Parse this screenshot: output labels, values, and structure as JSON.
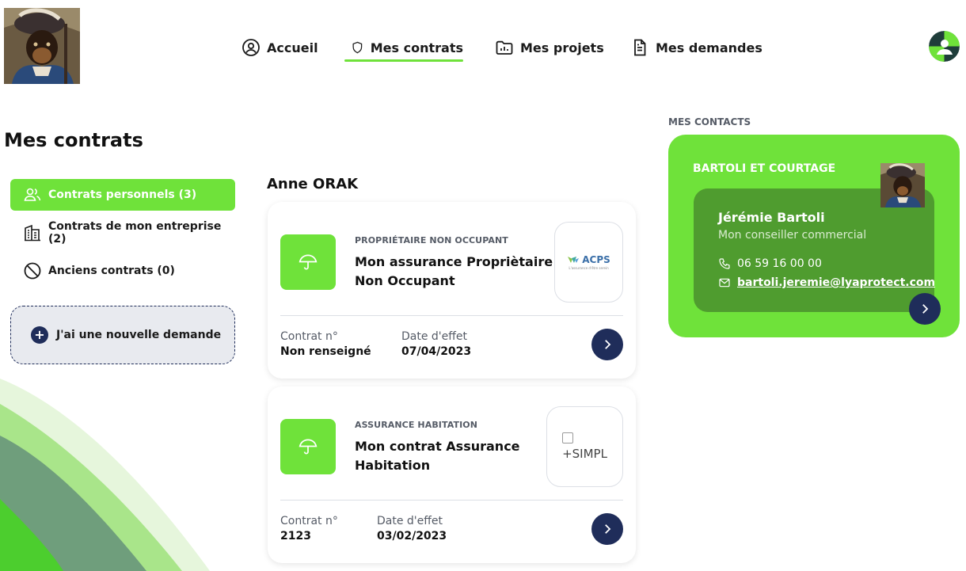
{
  "colors": {
    "accent": "#6fe23a",
    "dark_navy": "#1f2d5a",
    "advisor_box": "#4f9c2f"
  },
  "header": {
    "logo_icon": "dog-portrait-logo",
    "nav": [
      {
        "label": "Accueil",
        "icon": "user-circle-icon"
      },
      {
        "label": "Mes contrats",
        "icon": "shield-icon",
        "active": true
      },
      {
        "label": "Mes projets",
        "icon": "folder-chart-icon"
      },
      {
        "label": "Mes demandes",
        "icon": "document-icon"
      }
    ],
    "avatar_icon": "user-avatar-icon"
  },
  "page": {
    "title": "Mes contrats"
  },
  "sidebar": {
    "items": [
      {
        "label": "Contrats personnels (3)",
        "icon": "users-icon",
        "active": true
      },
      {
        "label": "Contrats de mon entreprise (2)",
        "icon": "building-icon"
      },
      {
        "label": "Anciens contrats (0)",
        "icon": "ban-icon"
      }
    ],
    "new_request_label": "J'ai une nouvelle demande"
  },
  "main": {
    "owner_name": "Anne ORAK",
    "contracts": [
      {
        "category": "PROPRIÉTAIRE NON OCCUPANT",
        "name": "Mon assurance Propriètaire Non Occupant",
        "insurer_logo_text": "ACPS",
        "insurer_logo_tagline": "L'assurance d'être serein",
        "contract_no_label": "Contrat n°",
        "contract_no": "Non renseigné",
        "effective_label": "Date d'effet",
        "effective_date": "07/04/2023",
        "icon": "umbrella-icon"
      },
      {
        "category": "ASSURANCE HABITATION",
        "name": "Mon contrat Assurance Habitation",
        "insurer_logo_text": "+SIMPL",
        "contract_no_label": "Contrat n°",
        "contract_no": "2123",
        "effective_label": "Date d'effet",
        "effective_date": "03/02/2023",
        "icon": "umbrella-icon"
      }
    ]
  },
  "contacts": {
    "section_label": "MES CONTACTS",
    "broker": "BARTOLI ET COURTAGE",
    "advisor": {
      "name": "Jérémie Bartoli",
      "role": "Mon conseiller commercial",
      "phone": "06 59 16 00 00",
      "email": "bartoli.jeremie@lyaprotect.com"
    }
  }
}
